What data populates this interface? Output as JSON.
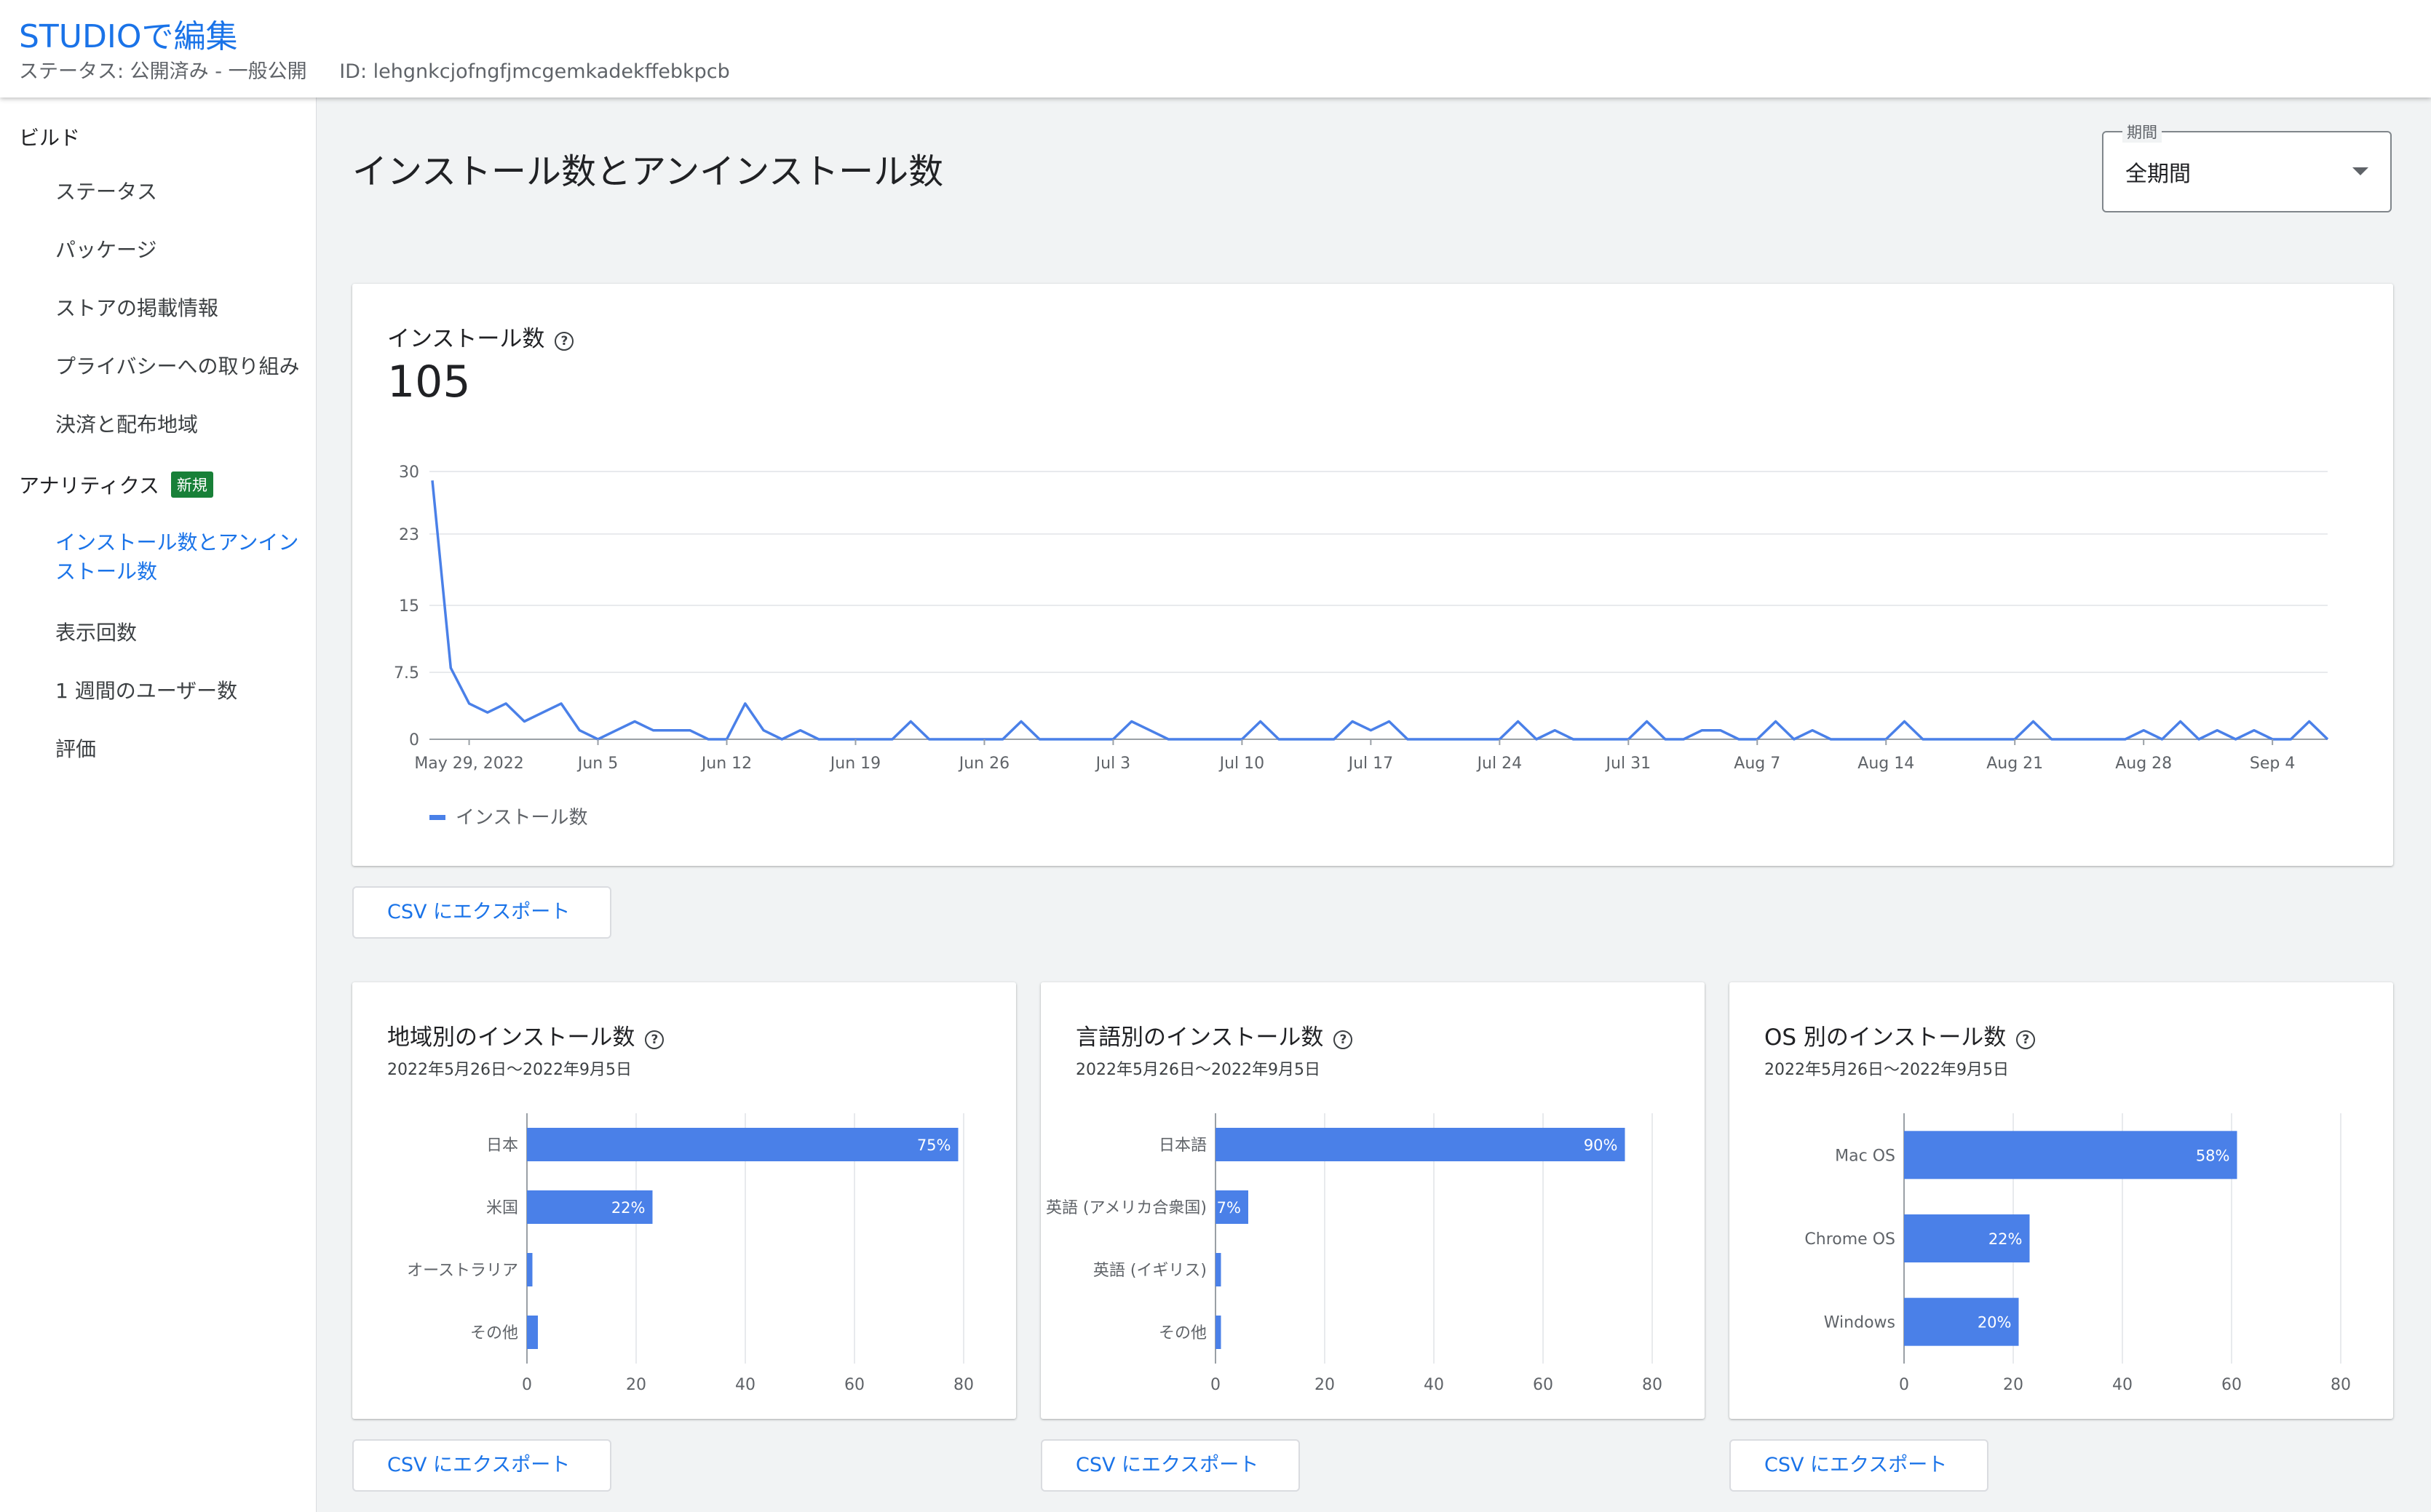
{
  "header": {
    "title": "STUDIOで編集",
    "status": "ステータス: 公開済み - 一般公開",
    "id": "ID: lehgnkcjofngfjmcgemkadekffebkpcb"
  },
  "sidebar": {
    "build_label": "ビルド",
    "build_items": [
      "ステータス",
      "パッケージ",
      "ストアの掲載情報",
      "プライバシーへの取り組み",
      "決済と配布地域"
    ],
    "analytics_label": "アナリティクス",
    "analytics_badge": "新規",
    "analytics_active_line1": "インストール数とアンイン",
    "analytics_active_line2": "ストール数",
    "analytics_items": [
      "表示回数",
      "1 週間のユーザー数",
      "評価"
    ]
  },
  "page": {
    "title": "インストール数とアンインストール数",
    "period_label": "期間",
    "period_value": "全期間"
  },
  "installs_card": {
    "title": "インストール数",
    "total": "105",
    "csv_label": "CSV にエクスポート"
  },
  "colors": {
    "accent": "#1a73e8",
    "series": "#4a80e8"
  },
  "chart_data": [
    {
      "type": "line",
      "title": "インストール数",
      "y_ticks": [
        "30",
        "23",
        "15",
        "7.5",
        "0"
      ],
      "ylim": [
        0,
        30
      ],
      "x_ticks": [
        "May 29, 2022",
        "Jun 5",
        "Jun 12",
        "Jun 19",
        "Jun 26",
        "Jul 3",
        "Jul 10",
        "Jul 17",
        "Jul 24",
        "Jul 31",
        "Aug 7",
        "Aug 14",
        "Aug 21",
        "Aug 28",
        "Sep 4"
      ],
      "series": [
        {
          "name": "インストール数",
          "values": [
            29,
            8,
            4,
            3,
            4,
            2,
            3,
            4,
            1,
            0,
            1,
            2,
            1,
            1,
            1,
            0,
            0,
            4,
            1,
            0,
            1,
            0,
            0,
            0,
            0,
            0,
            2,
            0,
            0,
            0,
            0,
            0,
            2,
            0,
            0,
            0,
            0,
            0,
            2,
            1,
            0,
            0,
            0,
            0,
            0,
            2,
            0,
            0,
            0,
            0,
            2,
            1,
            2,
            0,
            0,
            0,
            0,
            0,
            0,
            2,
            0,
            1,
            0,
            0,
            0,
            0,
            2,
            0,
            0,
            1,
            1,
            0,
            0,
            2,
            0,
            1,
            0,
            0,
            0,
            0,
            2,
            0,
            0,
            0,
            0,
            0,
            0,
            2,
            0,
            0,
            0,
            0,
            0,
            1,
            0,
            2,
            0,
            1,
            0,
            1,
            0,
            0,
            2,
            0
          ]
        }
      ]
    },
    {
      "type": "bar",
      "title": "地域別のインストール数",
      "date_range": "2022年5月26日〜2022年9月5日",
      "categories": [
        "日本",
        "米国",
        "オーストラリア",
        "その他"
      ],
      "values": [
        79,
        23,
        1,
        2
      ],
      "labels": [
        "75%",
        "22%",
        "",
        ""
      ],
      "xlim": [
        0,
        80
      ],
      "x_ticks": [
        "0",
        "20",
        "40",
        "60",
        "80"
      ],
      "csv_label": "CSV にエクスポート"
    },
    {
      "type": "bar",
      "title": "言語別のインストール数",
      "date_range": "2022年5月26日〜2022年9月5日",
      "categories": [
        "日本語",
        "英語 (アメリカ合衆国)",
        "英語 (イギリス)",
        "その他"
      ],
      "values": [
        75,
        6,
        1,
        1
      ],
      "labels": [
        "90%",
        "7%",
        "",
        ""
      ],
      "xlim": [
        0,
        80
      ],
      "x_ticks": [
        "0",
        "20",
        "40",
        "60",
        "80"
      ],
      "csv_label": "CSV にエクスポート"
    },
    {
      "type": "bar",
      "title": "OS 別のインストール数",
      "date_range": "2022年5月26日〜2022年9月5日",
      "categories": [
        "Mac OS",
        "Chrome OS",
        "Windows"
      ],
      "values": [
        61,
        23,
        21
      ],
      "labels": [
        "58%",
        "22%",
        "20%"
      ],
      "xlim": [
        0,
        80
      ],
      "x_ticks": [
        "0",
        "20",
        "40",
        "60",
        "80"
      ],
      "csv_label": "CSV にエクスポート"
    }
  ]
}
